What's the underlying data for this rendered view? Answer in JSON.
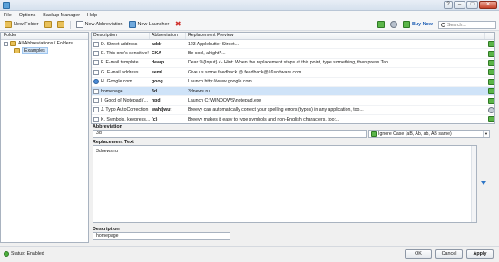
{
  "menubar": {
    "items": [
      "File",
      "Options",
      "Backup Manager",
      "Help"
    ]
  },
  "toolbar": {
    "new_folder": "New Folder",
    "new_abbreviation": "New Abbreviation",
    "new_launcher": "New Launcher",
    "buy_now": "Buy Now",
    "search_placeholder": "Search..."
  },
  "folders": {
    "header": "Folder",
    "root": "All Abbreviations / Folders",
    "child": "Examples"
  },
  "list": {
    "columns": [
      "Description",
      "Abbreviation",
      "Replacement Preview"
    ],
    "rows": [
      {
        "desc": "D. Street address",
        "abbr": "addr",
        "preview": "123 Applebutter Street...",
        "status": "ok",
        "icon": "doc"
      },
      {
        "desc": "E. This one's sensitive!",
        "abbr": "EKA",
        "preview": "Be cool, alright?...",
        "status": "ok",
        "icon": "doc"
      },
      {
        "desc": "F. E-mail template",
        "abbr": "dearp",
        "preview": "Dear %{Input} <- Hint: When the replacement stops at this point, type something, then press Tab...",
        "status": "ok",
        "icon": "doc"
      },
      {
        "desc": "G. E-mail address",
        "abbr": "eeml",
        "preview": "Give us some feedback @ feedback@16software.com...",
        "status": "ok",
        "icon": "doc"
      },
      {
        "desc": "H. Google.com",
        "abbr": "goog",
        "preview": "Launch http://www.google.com",
        "status": "ok",
        "icon": "google"
      },
      {
        "desc": "homepage",
        "abbr": "3d",
        "preview": "3dnews.ru",
        "status": "ok",
        "icon": "doc"
      },
      {
        "desc": "I. Good ol' Notepad (...",
        "abbr": "npd",
        "preview": "Launch C:\\WINDOWS\\notepad.exe",
        "status": "ok",
        "icon": "doc"
      },
      {
        "desc": "J. Typo AutoCorrection",
        "abbr": "waht|wut",
        "preview": "Breevy can automatically correct your spelling errors (typos) in any application, too...",
        "status": "gear",
        "icon": "doc"
      },
      {
        "desc": "K. Symbols, keypress...",
        "abbr": "(c)",
        "preview": "Breevy makes it easy to type symbols and non-English characters, too:...",
        "status": "ok",
        "icon": "doc"
      }
    ],
    "selected_index": 5
  },
  "editor": {
    "abbreviation_label": "Abbreviation",
    "abbreviation_value": "3d",
    "case_option": "Ignore Case (aB, Ab, ab, AB same)",
    "replacement_label": "Replacement Text",
    "replacement_value": "3dnews.ru",
    "description_label": "Description",
    "description_value": "homepage"
  },
  "statusbar": {
    "status": "Status: Enabled",
    "ok": "OK",
    "cancel": "Cancel",
    "apply": "Apply"
  },
  "colors": {
    "accent_blue": "#1f5fb4",
    "status_green": "#4cae3c",
    "delete_red": "#d0312d"
  }
}
